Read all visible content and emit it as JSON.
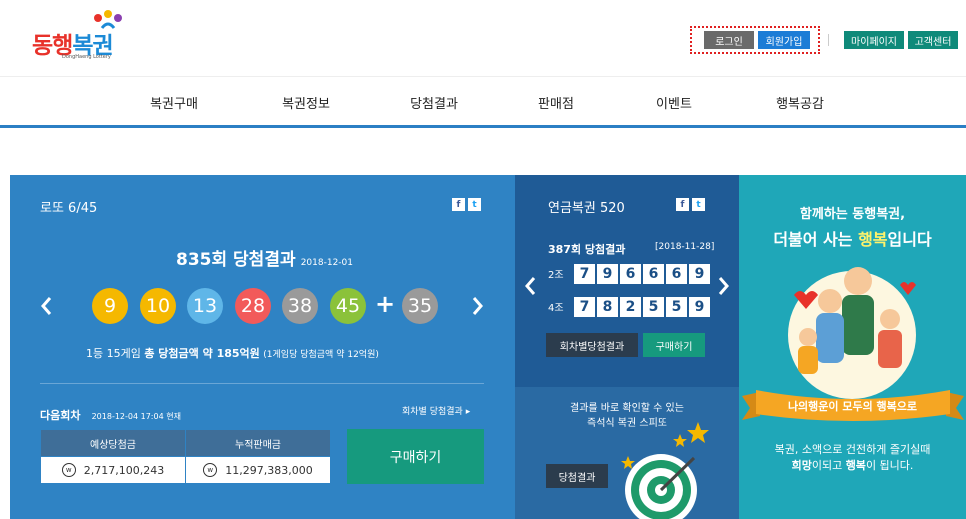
{
  "header": {
    "logo_text_a": "동행",
    "logo_text_b": "복권",
    "logo_sub": "DongHaeng Lottery",
    "login_label": "로그인",
    "join_label": "회원가입",
    "mypage_label": "마이페이지",
    "support_label": "고객센터"
  },
  "nav": {
    "items": [
      "복권구매",
      "복권정보",
      "당첨결과",
      "판매점",
      "이벤트",
      "행복공감"
    ]
  },
  "lotto": {
    "title": "로또 6/45",
    "round_title": "835회 당첨결과",
    "round_date": "2018-12-01",
    "numbers": [
      "9",
      "10",
      "13",
      "28",
      "38",
      "45"
    ],
    "plus": "+",
    "bonus": "35",
    "ball_colors": [
      "#f5b800",
      "#f5b800",
      "#5fb6e8",
      "#f25a5a",
      "#9a9a9a",
      "#8bc23a",
      "#9a9a9a"
    ],
    "prize_pre": "1등 15게임",
    "prize_bold": "총 당첨금액 약 185억원",
    "prize_sub": "(1게임당 당첨금액 약 12억원)",
    "next_label": "다음회차",
    "next_time": "2018-12-04 17:04 현재",
    "by_round_link": "회차별 당첨결과",
    "col_expected": "예상당첨금",
    "col_sales": "누적판매금",
    "expected_value": "2,717,100,243",
    "sales_value": "11,297,383,000",
    "buy_label": "구매하기",
    "won_symbol": "w"
  },
  "pension": {
    "title": "연금복권 520",
    "round_title": "387회 당첨결과",
    "round_date": "[2018-11-28]",
    "row1_label": "2조",
    "row1_numbers": [
      "7",
      "9",
      "6",
      "6",
      "6",
      "9"
    ],
    "row2_label": "4조",
    "row2_numbers": [
      "7",
      "8",
      "2",
      "5",
      "5",
      "9"
    ],
    "by_round_button": "회차별당첨결과",
    "buy_button": "구매하기"
  },
  "speetto": {
    "line1": "결과를 바로 확인할 수 있는",
    "line2": "즉석식 복권 스피또",
    "result_button": "당첨결과"
  },
  "promo": {
    "line1": "함께하는 동행복권,",
    "line2a": "더불어 사는 ",
    "line2b": "행복",
    "line2c": "입니다",
    "ribbon": "나의행운이 모두의 행복으로",
    "foot1": "복권, 소액으로 건전하게 즐기실때",
    "foot2a": "희망",
    "foot2b": "이되고 ",
    "foot2c": "행복",
    "foot2d": "이 됩니다."
  },
  "social": {
    "facebook": "f",
    "twitter": "t"
  },
  "icons": {
    "prev": "chevron-left-icon",
    "next": "chevron-right-icon"
  }
}
